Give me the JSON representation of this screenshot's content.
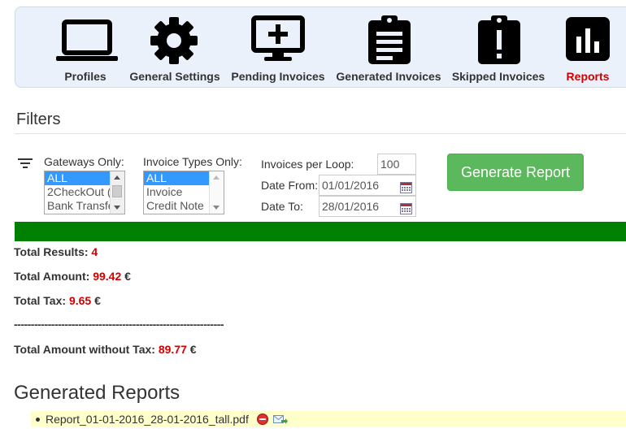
{
  "nav": {
    "items": [
      {
        "label": "Profiles",
        "icon": "laptop-icon"
      },
      {
        "label": "General Settings",
        "icon": "gear-icon"
      },
      {
        "label": "Pending Invoices",
        "icon": "monitor-plus-icon"
      },
      {
        "label": "Generated Invoices",
        "icon": "clipboard-list-icon"
      },
      {
        "label": "Skipped Invoices",
        "icon": "clipboard-exclamation-icon"
      },
      {
        "label": "Reports",
        "icon": "bar-chart-icon",
        "active": true
      }
    ]
  },
  "filters": {
    "title": "Filters",
    "gateways": {
      "label": "Gateways Only:",
      "options": [
        "ALL",
        "2CheckOut (",
        "Bank Transfe"
      ],
      "selected": "ALL"
    },
    "invoice_types": {
      "label": "Invoice Types Only:",
      "options": [
        "ALL",
        "Invoice",
        "Credit Note"
      ],
      "selected": "ALL"
    },
    "per_loop": {
      "label": "Invoices per Loop:",
      "value": "100"
    },
    "date_from": {
      "label": "Date From:",
      "value": "01/01/2016"
    },
    "date_to": {
      "label": "Date To:",
      "value": "28/01/2016"
    },
    "generate_button": "Generate Report"
  },
  "progress": {
    "percent": 100
  },
  "summary": {
    "total_results": {
      "label": "Total Results:",
      "value": "4"
    },
    "total_amount": {
      "label": "Total Amount:",
      "value": "99.42",
      "unit": "€"
    },
    "total_tax": {
      "label": "Total Tax:",
      "value": "9.65",
      "unit": "€"
    },
    "separator": "--------------------------------------------------------------",
    "total_without_tax": {
      "label": "Total Amount without Tax:",
      "value": "89.77",
      "unit": "€"
    }
  },
  "reports": {
    "title": "Generated Reports",
    "files": [
      {
        "name": "Report_01-01-2016_28-01-2016_tall.pdf"
      }
    ]
  },
  "colors": {
    "accent_red": "#d00000",
    "button_green": "#5cb85c",
    "progress_green": "#008000",
    "nav_bg": "#eaf1fa",
    "report_highlight": "#ffffcc"
  }
}
